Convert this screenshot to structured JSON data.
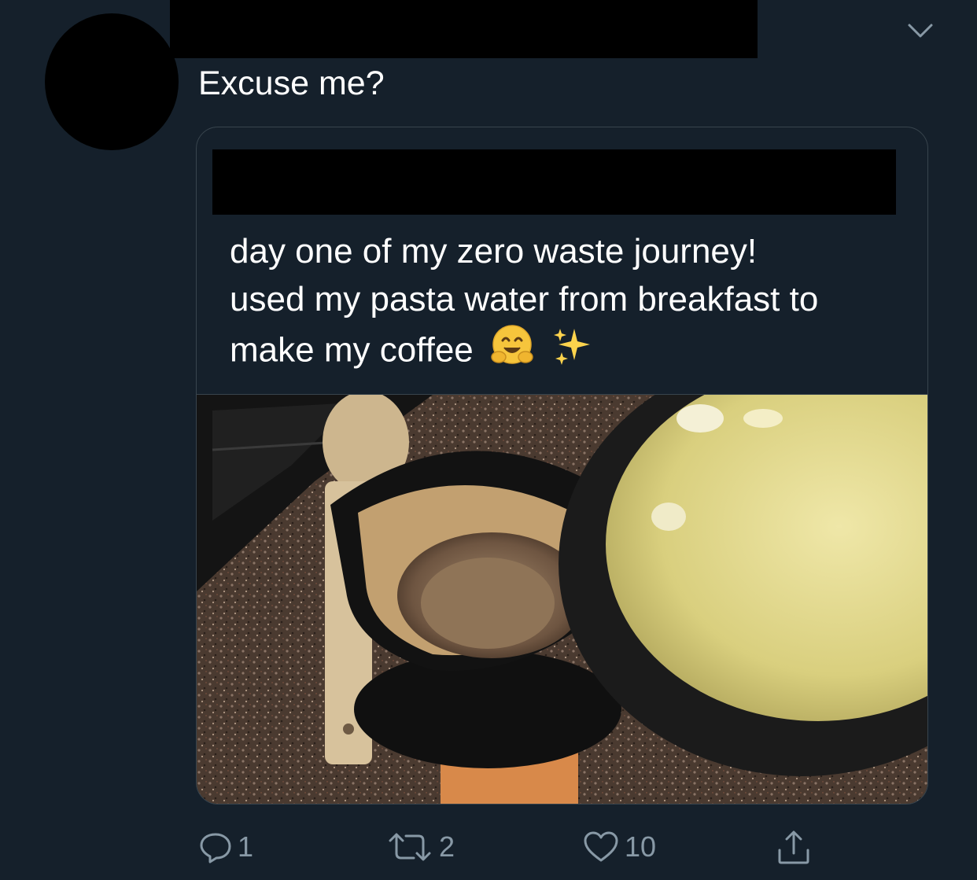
{
  "tweet": {
    "text": "Excuse me?",
    "menu_icon": "chevron-down-icon"
  },
  "quoted_tweet": {
    "lines": [
      "day one of my zero waste journey!",
      "used my pasta water from breakfast to",
      "make my coffee"
    ],
    "emojis": [
      "hugging-face-emoji",
      "sparkles-emoji"
    ],
    "photo_description": "coffee"
  },
  "actions": {
    "reply": {
      "icon": "reply-icon",
      "count": "1"
    },
    "retweet": {
      "icon": "retweet-icon",
      "count": "2"
    },
    "like": {
      "icon": "heart-icon",
      "count": "10"
    },
    "share": {
      "icon": "share-icon"
    }
  },
  "colors": {
    "background": "#15202b",
    "border": "#38444d",
    "muted": "#8899a6",
    "text": "#ffffff"
  }
}
